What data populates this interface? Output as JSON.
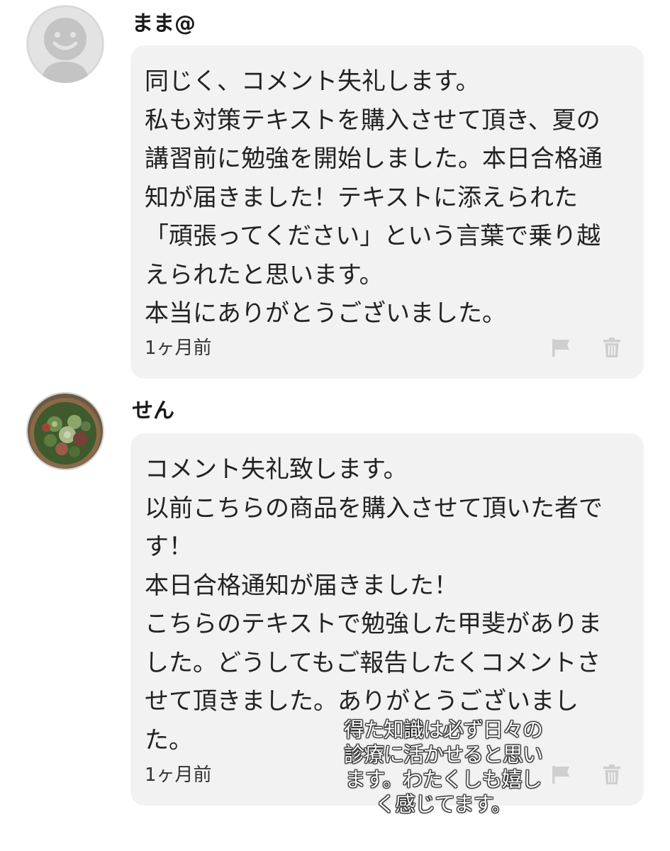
{
  "comments": [
    {
      "username": "まま@",
      "avatar": "default-person-avatar",
      "lines": [
        "同じく、コメント失礼します。",
        "私も対策テキストを購入させて頂き、夏の",
        "講習前に勉強を開始しました。本日合格通",
        "知が届きました！テキストに添えられた",
        "「頑張ってください」という言葉で乗り越",
        "えられたと思います。",
        "本当にありがとうございました。"
      ],
      "time": "1ヶ月前",
      "icons": [
        "flag-icon",
        "trash-icon"
      ]
    },
    {
      "username": "せん",
      "avatar": "succulent-photo-avatar",
      "lines": [
        "コメント失礼致します。",
        "以前こちらの商品を購入させて頂いた者で",
        "す！",
        "本日合格通知が届きました！",
        "こちらのテキストで勉強した甲斐がありま",
        "した。どうしてもご報告したくコメントさ",
        "せて頂きました。ありがとうございまし",
        "た。"
      ],
      "time": "1ヶ月前",
      "icons": [
        "flag-icon",
        "trash-icon"
      ]
    }
  ],
  "overlay_caption": {
    "lines": [
      "得た知識は必ず日々の",
      "診療に活かせると思い",
      "ます。わたくしも嬉し",
      "く感じてます。"
    ]
  },
  "colors": {
    "bubble": "#f2f2f2",
    "icon_gray": "#cfcfcf",
    "text": "#222222"
  }
}
